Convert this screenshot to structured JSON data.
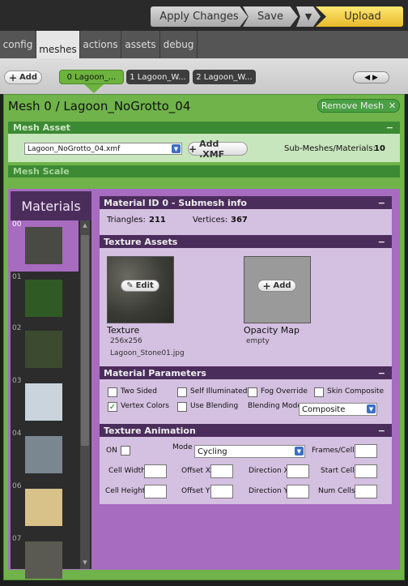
{
  "toolbar": {
    "apply": "Apply Changes",
    "save": "Save",
    "dropdown": "▼",
    "upload": "Upload"
  },
  "tabs": [
    "config",
    "meshes",
    "actions",
    "assets",
    "debug"
  ],
  "meshbar": {
    "add": "Add",
    "mesh_tabs": [
      "0 Lagoon_...",
      "1 Lagoon_W...",
      "2 Lagoon_W..."
    ]
  },
  "mesh": {
    "title": "Mesh 0 / Lagoon_NoGrotto_04",
    "remove": "Remove Mesh",
    "asset_header": "Mesh Asset",
    "file_value": "Lagoon_NoGrotto_04.xmf",
    "add_xmf": "Add .XMF",
    "submesh_label": "Sub-Meshes/Materials:",
    "submesh_count": "10",
    "scale_header": "Mesh Scale"
  },
  "materials": {
    "header": "Materials",
    "items": [
      {
        "num": "00",
        "color": "#4a4a44"
      },
      {
        "num": "01",
        "color": "#2f5a24"
      },
      {
        "num": "02",
        "color": "#3c4a30"
      },
      {
        "num": "03",
        "color": "#c9d4dc"
      },
      {
        "num": "04",
        "color": "#7a8690"
      },
      {
        "num": "06",
        "color": "#d8c28a"
      },
      {
        "num": "07",
        "color": "#5a5a52"
      }
    ]
  },
  "info": {
    "header": "Material ID 0 - Submesh info",
    "tri_label": "Triangles:",
    "tri_value": "211",
    "vert_label": "Vertices:",
    "vert_value": "367"
  },
  "texture": {
    "header": "Texture Assets",
    "tex_label": "Texture",
    "tex_size": "256x256",
    "tex_file": "Lagoon_Stone01.jpg",
    "edit": "Edit",
    "op_label": "Opacity Map",
    "op_status": "empty",
    "add": "Add"
  },
  "params": {
    "header": "Material Parameters",
    "two_sided": "Two Sided",
    "self_illum": "Self Illuminated",
    "fog": "Fog Override",
    "skin": "Skin Composite",
    "vertex_colors": "Vertex Colors",
    "use_blending": "Use Blending",
    "blend_mode_label": "Blending Mode",
    "blend_mode_value": "Composite",
    "vertex_colors_checked": "✓"
  },
  "anim": {
    "header": "Texture Animation",
    "on": "ON",
    "mode_label": "Mode",
    "mode_value": "Cycling",
    "frames_cell": "Frames/Cell",
    "cell_width": "Cell Width",
    "offset_x": "Offset X",
    "direction_x": "Direction X",
    "start_cell": "Start Cell",
    "cell_height": "Cell Height",
    "offset_y": "Offset Y",
    "direction_y": "Direction Y",
    "num_cells": "Num Cells"
  },
  "collapse": "−"
}
